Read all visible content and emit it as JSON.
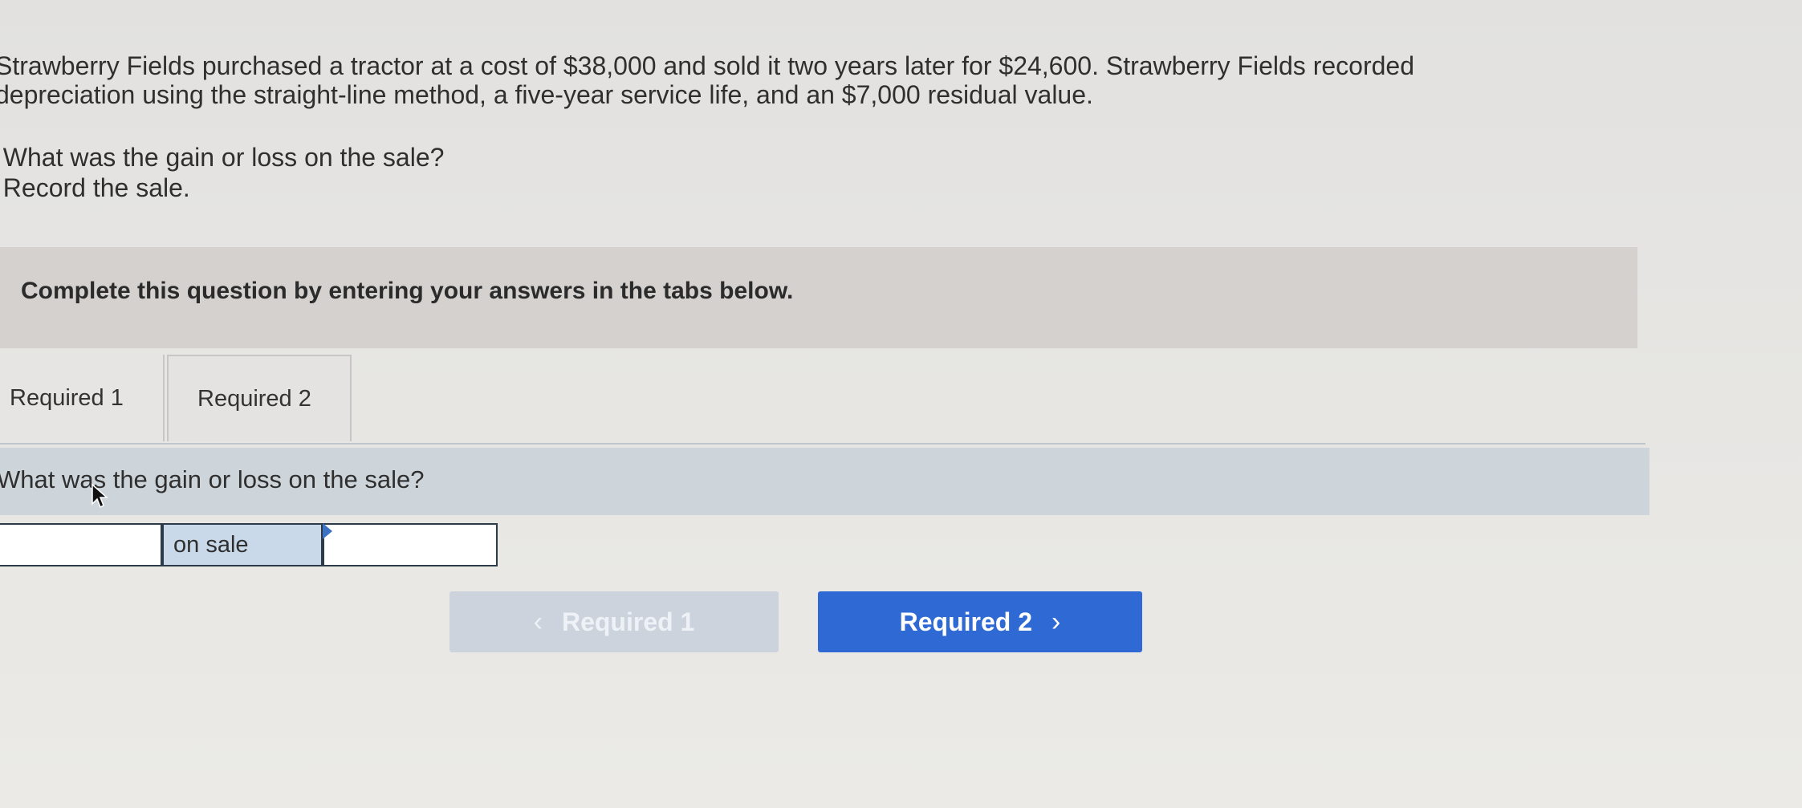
{
  "problem": {
    "line1": "Strawberry Fields purchased a tractor at a cost of $38,000 and sold it two years later for $24,600. Strawberry Fields recorded",
    "line2": "depreciation using the straight-line method, a five-year service life, and an $7,000 residual value."
  },
  "requirements": [
    {
      "text": ". What was the gain or loss on the sale?"
    },
    {
      "text": ". Record the sale."
    }
  ],
  "instruction": "Complete this question by entering your answers in the tabs below.",
  "tabs": [
    {
      "label": "Required 1",
      "active": true
    },
    {
      "label": "Required 2",
      "active": false
    }
  ],
  "question": "What was the gain or loss on the sale?",
  "answer": {
    "label": "on sale",
    "left_value": "",
    "right_value": ""
  },
  "nav": {
    "prev_label": "Required 1",
    "next_label": "Required 2"
  },
  "colors": {
    "accent": "#2f6ad4",
    "disabled": "#ccd3dc",
    "question_bg": "#cdd5db"
  }
}
